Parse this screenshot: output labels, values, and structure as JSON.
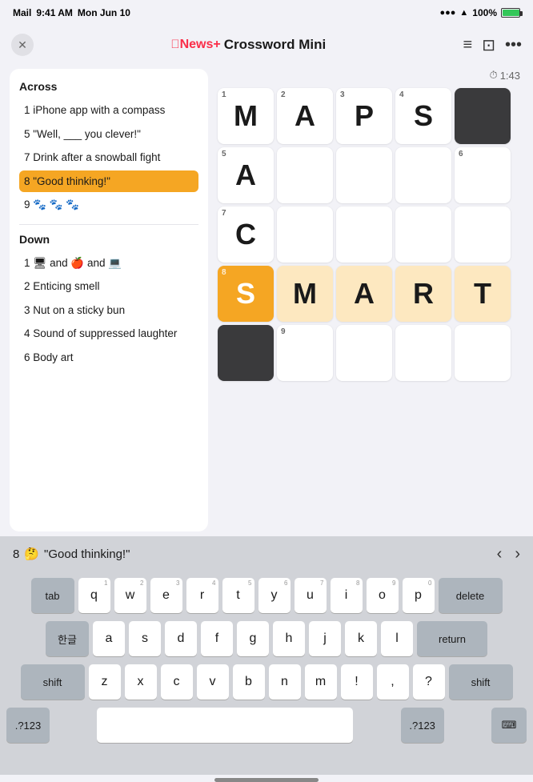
{
  "statusBar": {
    "carrier": "Mail",
    "time": "9:41 AM",
    "date": "Mon Jun 10",
    "wifi": true,
    "battery": "100%"
  },
  "header": {
    "title": "Crossword Mini",
    "brand": "News+",
    "appleSymbol": ""
  },
  "timer": "1:43",
  "clues": {
    "across": {
      "label": "Across",
      "items": [
        {
          "number": "1",
          "text": "iPhone app with a compass"
        },
        {
          "number": "5",
          "text": "\"Well, ___ you clever!\""
        },
        {
          "number": "7",
          "text": "Drink after a snowball fight"
        },
        {
          "number": "8",
          "text": "\"Good thinking!\"",
          "active": true
        },
        {
          "number": "9",
          "text": "🐾 🐾 🐾"
        }
      ]
    },
    "down": {
      "label": "Down",
      "items": [
        {
          "number": "1",
          "text": "🖥 and 🍎 and 💻",
          "emoji": true
        },
        {
          "number": "2",
          "text": "Enticing smell"
        },
        {
          "number": "3",
          "text": "Nut on a sticky bun"
        },
        {
          "number": "4",
          "text": "Sound of suppressed laughter"
        },
        {
          "number": "6",
          "text": "Body art"
        }
      ]
    }
  },
  "grid": {
    "cells": [
      {
        "row": 0,
        "col": 0,
        "number": "1",
        "letter": "M",
        "state": "normal"
      },
      {
        "row": 0,
        "col": 1,
        "number": "2",
        "letter": "A",
        "state": "normal"
      },
      {
        "row": 0,
        "col": 2,
        "number": "3",
        "letter": "P",
        "state": "normal"
      },
      {
        "row": 0,
        "col": 3,
        "number": "4",
        "letter": "S",
        "state": "normal"
      },
      {
        "row": 0,
        "col": 4,
        "letter": "",
        "state": "filled"
      },
      {
        "row": 1,
        "col": 0,
        "number": "5",
        "letter": "A",
        "state": "normal"
      },
      {
        "row": 1,
        "col": 1,
        "letter": "",
        "state": "normal"
      },
      {
        "row": 1,
        "col": 2,
        "letter": "",
        "state": "normal"
      },
      {
        "row": 1,
        "col": 3,
        "letter": "",
        "state": "normal"
      },
      {
        "row": 1,
        "col": 4,
        "number": "6",
        "letter": "",
        "state": "normal"
      },
      {
        "row": 2,
        "col": 0,
        "number": "7",
        "letter": "C",
        "state": "normal"
      },
      {
        "row": 2,
        "col": 1,
        "letter": "",
        "state": "normal"
      },
      {
        "row": 2,
        "col": 2,
        "letter": "",
        "state": "normal"
      },
      {
        "row": 2,
        "col": 3,
        "letter": "",
        "state": "normal"
      },
      {
        "row": 2,
        "col": 4,
        "letter": "",
        "state": "normal"
      },
      {
        "row": 3,
        "col": 0,
        "number": "8",
        "letter": "S",
        "state": "active-current"
      },
      {
        "row": 3,
        "col": 1,
        "letter": "M",
        "state": "active-row"
      },
      {
        "row": 3,
        "col": 2,
        "letter": "A",
        "state": "active-row"
      },
      {
        "row": 3,
        "col": 3,
        "letter": "R",
        "state": "active-row"
      },
      {
        "row": 3,
        "col": 4,
        "letter": "T",
        "state": "active-row"
      },
      {
        "row": 4,
        "col": 0,
        "letter": "",
        "state": "filled"
      },
      {
        "row": 4,
        "col": 1,
        "number": "9",
        "letter": "",
        "state": "normal"
      },
      {
        "row": 4,
        "col": 2,
        "letter": "",
        "state": "normal"
      },
      {
        "row": 4,
        "col": 3,
        "letter": "",
        "state": "normal"
      },
      {
        "row": 4,
        "col": 4,
        "letter": "",
        "state": "normal"
      }
    ]
  },
  "clueBar": {
    "clueRef": "8",
    "clueEmoji": "🤔",
    "clueText": "\"Good thinking!\""
  },
  "keyboard": {
    "row1": [
      "q",
      "w",
      "e",
      "r",
      "t",
      "y",
      "u",
      "i",
      "o",
      "p"
    ],
    "row1subs": [
      "1",
      "2",
      "3",
      "4",
      "5",
      "6",
      "7",
      "8",
      "9",
      "0"
    ],
    "row2": [
      "a",
      "s",
      "d",
      "f",
      "g",
      "h",
      "j",
      "k",
      "l"
    ],
    "row2subs": [
      "",
      "",
      "",
      "",
      "",
      "",
      "",
      "",
      ""
    ],
    "row3": [
      "z",
      "x",
      "c",
      "v",
      "b",
      "n",
      "m",
      "!",
      ",",
      "?"
    ],
    "specialLeft": "shift",
    "specialRight": "shift",
    "bottomLeft": ".?123",
    "bottomRight": ".?123",
    "space": "",
    "deleteLabel": "delete",
    "returnLabel": "return",
    "tabLabel": "tab",
    "koreanLabel": "한글"
  }
}
